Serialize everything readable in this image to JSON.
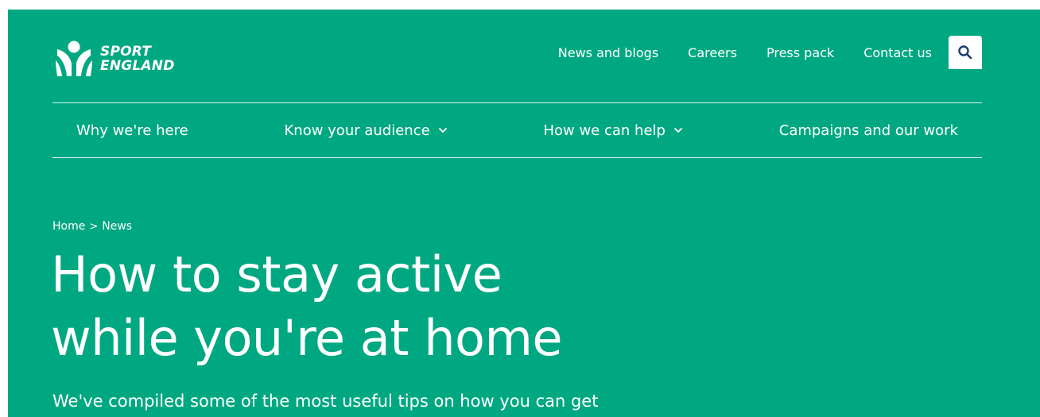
{
  "logo": {
    "line1": "SPORT",
    "line2": "ENGLAND",
    "icon": "sport-england-logo-icon"
  },
  "top_nav": {
    "items": [
      "News and blogs",
      "Careers",
      "Press pack",
      "Contact us"
    ],
    "search_icon": "search-icon"
  },
  "main_nav": {
    "items": [
      {
        "label": "Why we're here",
        "dropdown": false
      },
      {
        "label": "Know your audience",
        "dropdown": true
      },
      {
        "label": "How we can help",
        "dropdown": true
      },
      {
        "label": "Campaigns and our work",
        "dropdown": false
      }
    ]
  },
  "breadcrumb": {
    "home": "Home",
    "separator": ">",
    "current": "News"
  },
  "hero": {
    "title_line1": "How to stay active",
    "title_line2": "while you're at home",
    "intro": "We've compiled some of the most useful tips on how you can get"
  },
  "colors": {
    "brand_green": "#00a881",
    "text": "#ffffff",
    "search_icon_color": "#1d3a6e"
  }
}
